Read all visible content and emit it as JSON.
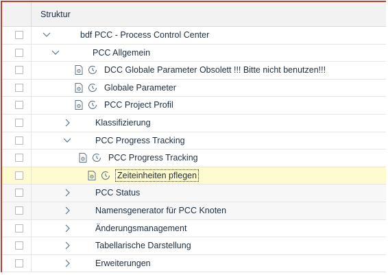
{
  "header": {
    "column_title": "Struktur"
  },
  "tree": [
    {
      "label": "bdf PCC - Process Control Center",
      "kind": "folder",
      "expanded": true
    },
    {
      "label": "PCC Allgemein",
      "kind": "folder",
      "expanded": true
    },
    {
      "label": "DCC Globale Parameter  Obsolett !!! Bitte nicht benutzen!!!",
      "kind": "leaf"
    },
    {
      "label": "Globale Parameter",
      "kind": "leaf"
    },
    {
      "label": "PCC Project Profil",
      "kind": "leaf"
    },
    {
      "label": "Klassifizierung",
      "kind": "folder",
      "expanded": false
    },
    {
      "label": "PCC Progress Tracking",
      "kind": "folder",
      "expanded": true
    },
    {
      "label": "PCC Progress Tracking",
      "kind": "leaf"
    },
    {
      "label": "Zeiteinheiten pflegen",
      "kind": "leaf",
      "selected": true
    },
    {
      "label": "PCC Status",
      "kind": "folder",
      "expanded": false
    },
    {
      "label": "Namensgenerator für PCC Knoten",
      "kind": "folder",
      "expanded": false
    },
    {
      "label": "Änderungsmanagement",
      "kind": "folder",
      "expanded": false
    },
    {
      "label": "Tabellarische Darstellung",
      "kind": "folder",
      "expanded": false
    },
    {
      "label": "Erweiterungen",
      "kind": "folder",
      "expanded": false
    }
  ],
  "icons": {
    "expanded": "chevron-down-icon",
    "collapsed": "chevron-right-icon",
    "document": "document-settings-icon",
    "activity": "clock-activity-icon"
  }
}
